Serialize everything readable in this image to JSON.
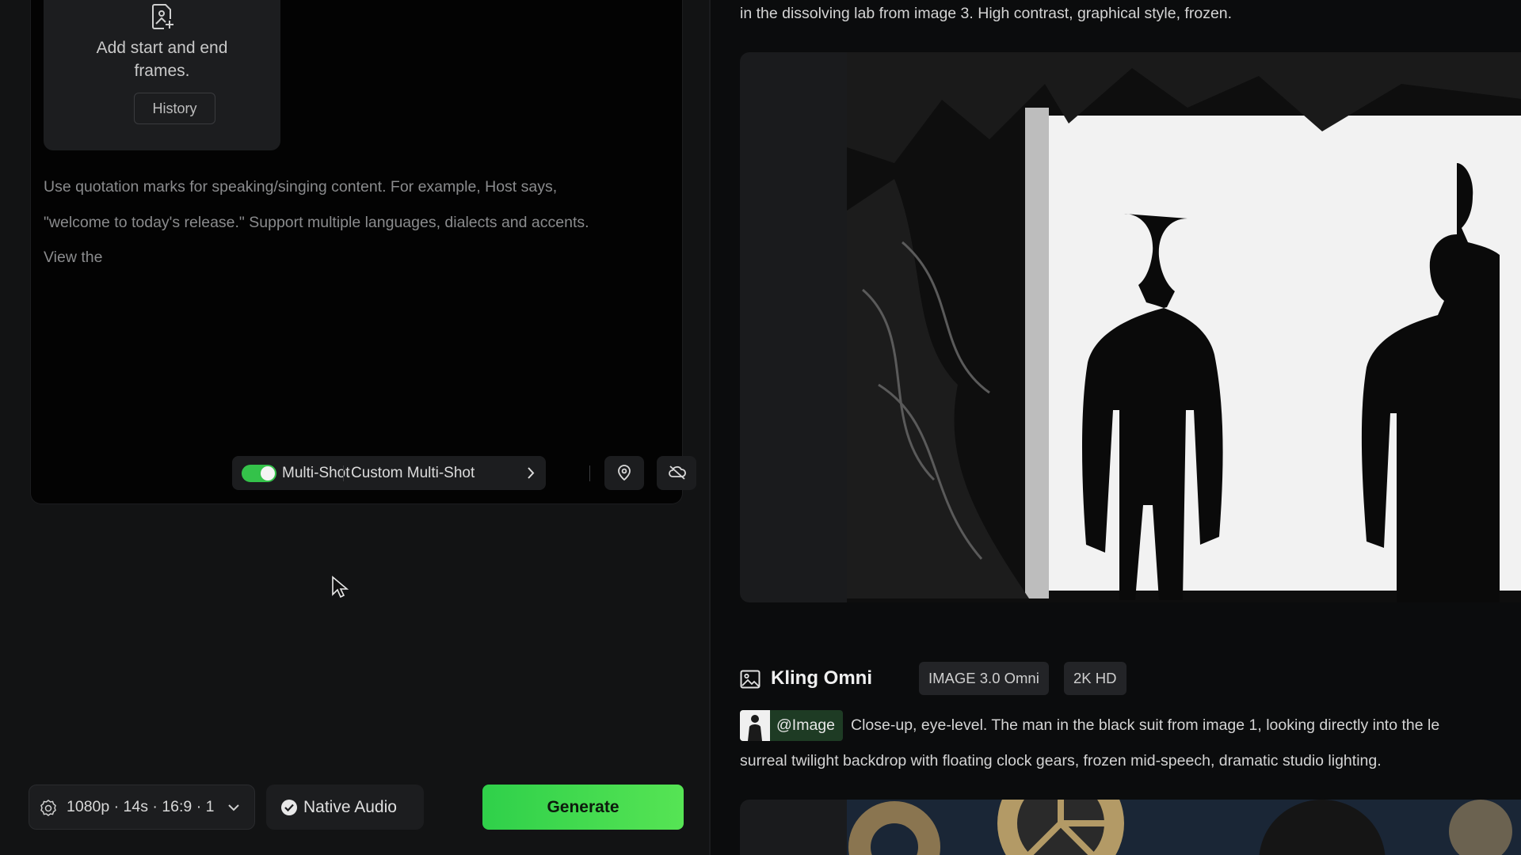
{
  "editor": {
    "frames_card": {
      "text": "Add start and end frames.",
      "history_label": "History"
    },
    "hint": {
      "line1": "Use quotation marks for speaking/singing content. For example, Host says,",
      "line2": "\"welcome to today's release.\" Support multiple languages, dialects and accents.",
      "line3": "View the"
    },
    "controls": {
      "multishot_label": "Multi-Shot",
      "multishot_on": true,
      "custom_label": "Custom Multi-Shot",
      "icons": [
        "location-pin-icon",
        "cloud-off-icon"
      ]
    }
  },
  "bottom": {
    "settings_text": "1080p · 14s · 16:9 · 1",
    "audio_label": "Native Audio",
    "generate_label": "Generate"
  },
  "feed": {
    "top_prompt": "in the dissolving lab from image 3. High contrast, graphical style, frozen.",
    "item": {
      "model": "Kling Omni",
      "tags": [
        "IMAGE 3.0 Omni",
        "2K HD"
      ],
      "ref_chip": "@Image",
      "prompt_line1": "Close-up, eye-level. The man in the black suit from image 1, looking directly into the le",
      "prompt_line2": "surreal twilight backdrop with floating clock gears, frozen mid-speech, dramatic studio lighting."
    }
  },
  "colors": {
    "accent_green": "#34c24a",
    "generate_gradient_start": "#2fd04a",
    "generate_gradient_end": "#56e454",
    "chip_green": "#1e3b24"
  }
}
